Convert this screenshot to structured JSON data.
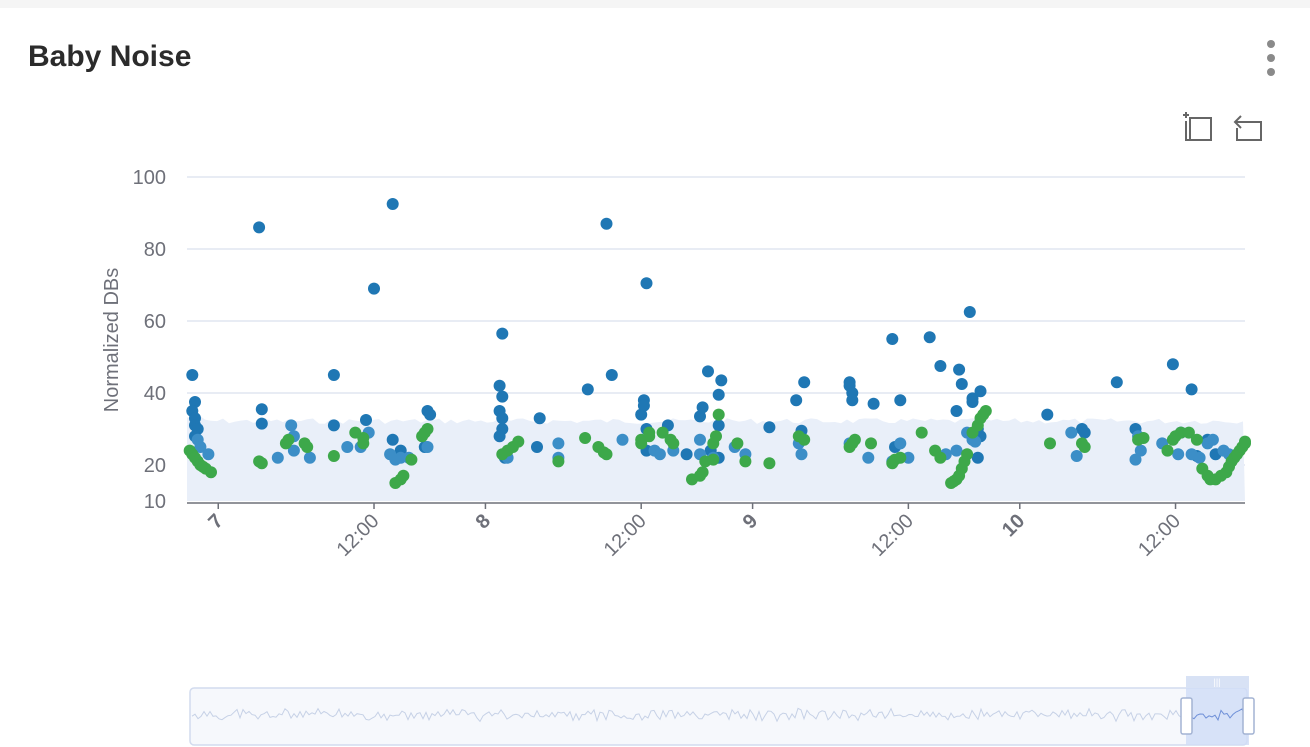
{
  "card": {
    "title": "Baby Noise"
  },
  "toolbox": {
    "zoom_icon": "zoom-area-icon",
    "restore_icon": "zoom-reset-icon",
    "menu_icon": "more-vert-icon"
  },
  "chart_data": {
    "type": "scatter",
    "title": "Baby Noise",
    "ylabel": "Normalized DBs",
    "xlabel": "",
    "x_unit": "day of month (fractional)",
    "xlim": [
      6.8,
      10.76
    ],
    "ylim": [
      10,
      100
    ],
    "y_ticks": [
      10,
      20,
      40,
      60,
      80,
      100
    ],
    "x_ticks": [
      {
        "x": 6.917,
        "label": "7",
        "bold": true
      },
      {
        "x": 7.5,
        "label": "12:00",
        "bold": false
      },
      {
        "x": 7.917,
        "label": "8",
        "bold": true
      },
      {
        "x": 8.5,
        "label": "12:00",
        "bold": false
      },
      {
        "x": 8.917,
        "label": "9",
        "bold": true
      },
      {
        "x": 9.5,
        "label": "12:00",
        "bold": false
      },
      {
        "x": 9.917,
        "label": "10",
        "bold": true
      },
      {
        "x": 10.5,
        "label": "12:00",
        "bold": false
      }
    ],
    "grid": true,
    "legend": "none",
    "colors": {
      "series_dark": "#1f77b4",
      "series_light": "#3c8ec7",
      "series_green": "#3da84a",
      "band": "#e9eff9",
      "grid": "#e0e6f1"
    },
    "band_upper": 33,
    "series": [
      {
        "color": "#1f77b4",
        "points": [
          [
            6.82,
            45
          ],
          [
            6.83,
            37.5
          ],
          [
            6.82,
            35
          ],
          [
            6.83,
            33
          ],
          [
            6.83,
            31
          ],
          [
            6.84,
            30
          ],
          [
            6.83,
            28
          ],
          [
            7.07,
            86
          ],
          [
            7.08,
            35.5
          ],
          [
            7.08,
            31.5
          ],
          [
            7.35,
            45
          ],
          [
            7.35,
            31
          ],
          [
            7.47,
            32.5
          ],
          [
            7.5,
            69
          ],
          [
            7.57,
            92.5
          ],
          [
            7.57,
            27
          ],
          [
            7.6,
            24
          ],
          [
            7.7,
            35
          ],
          [
            7.71,
            34
          ],
          [
            7.69,
            25
          ],
          [
            7.98,
            56.5
          ],
          [
            7.97,
            42
          ],
          [
            7.98,
            39
          ],
          [
            7.97,
            35
          ],
          [
            7.98,
            33
          ],
          [
            7.98,
            30
          ],
          [
            7.97,
            28
          ],
          [
            7.99,
            22
          ],
          [
            8.12,
            33
          ],
          [
            8.11,
            25
          ],
          [
            8.3,
            41
          ],
          [
            8.37,
            87
          ],
          [
            8.39,
            45
          ],
          [
            8.5,
            34
          ],
          [
            8.51,
            38
          ],
          [
            8.51,
            36.5
          ],
          [
            8.52,
            70.5
          ],
          [
            8.52,
            30
          ],
          [
            8.52,
            24
          ],
          [
            8.6,
            31
          ],
          [
            8.67,
            23
          ],
          [
            8.72,
            33.5
          ],
          [
            8.73,
            36
          ],
          [
            8.75,
            46
          ],
          [
            8.76,
            24
          ],
          [
            8.8,
            43.5
          ],
          [
            8.79,
            39.5
          ],
          [
            8.79,
            31
          ],
          [
            8.79,
            22
          ],
          [
            8.98,
            30.5
          ],
          [
            9.08,
            38
          ],
          [
            9.11,
            43
          ],
          [
            9.1,
            29.5
          ],
          [
            9.28,
            43
          ],
          [
            9.28,
            42
          ],
          [
            9.29,
            40
          ],
          [
            9.29,
            38
          ],
          [
            9.37,
            37
          ],
          [
            9.44,
            55
          ],
          [
            9.47,
            38
          ],
          [
            9.45,
            25
          ],
          [
            9.58,
            55.5
          ],
          [
            9.62,
            47.5
          ],
          [
            9.68,
            35
          ],
          [
            9.69,
            46.5
          ],
          [
            9.7,
            42.5
          ],
          [
            9.73,
            62.5
          ],
          [
            9.74,
            38.5
          ],
          [
            9.74,
            37.5
          ],
          [
            9.77,
            40.5
          ],
          [
            9.76,
            30
          ],
          [
            9.77,
            28
          ],
          [
            9.76,
            22
          ],
          [
            10.02,
            34
          ],
          [
            10.15,
            30
          ],
          [
            10.16,
            29
          ],
          [
            10.28,
            43
          ],
          [
            10.35,
            30
          ],
          [
            10.49,
            48
          ],
          [
            10.56,
            41
          ],
          [
            10.52,
            29
          ],
          [
            10.58,
            22.5
          ],
          [
            10.62,
            27
          ],
          [
            10.65,
            23
          ]
        ]
      },
      {
        "color": "#3c8ec7",
        "points": [
          [
            6.84,
            27
          ],
          [
            6.85,
            25
          ],
          [
            6.88,
            23
          ],
          [
            7.4,
            25
          ],
          [
            7.45,
            25
          ],
          [
            7.56,
            23
          ],
          [
            7.6,
            22
          ],
          [
            7.48,
            29
          ],
          [
            7.19,
            31
          ],
          [
            7.2,
            28
          ],
          [
            7.2,
            24
          ],
          [
            7.26,
            22
          ],
          [
            7.14,
            22
          ],
          [
            7.58,
            21.5
          ],
          [
            7.63,
            22
          ],
          [
            7.7,
            25
          ],
          [
            8.0,
            22
          ],
          [
            8.19,
            26
          ],
          [
            8.19,
            22
          ],
          [
            8.43,
            27
          ],
          [
            8.55,
            24
          ],
          [
            8.57,
            23
          ],
          [
            8.62,
            24
          ],
          [
            8.72,
            23
          ],
          [
            8.72,
            27
          ],
          [
            8.77,
            22
          ],
          [
            8.85,
            25
          ],
          [
            8.89,
            23
          ],
          [
            9.1,
            23
          ],
          [
            9.09,
            26
          ],
          [
            9.28,
            26
          ],
          [
            9.35,
            22
          ],
          [
            9.44,
            21
          ],
          [
            9.47,
            26
          ],
          [
            9.5,
            22
          ],
          [
            9.64,
            23
          ],
          [
            9.72,
            29
          ],
          [
            9.74,
            27
          ],
          [
            9.75,
            26.5
          ],
          [
            9.68,
            24
          ],
          [
            10.11,
            29
          ],
          [
            10.13,
            22.5
          ],
          [
            10.36,
            28
          ],
          [
            10.35,
            21.5
          ],
          [
            10.37,
            24
          ],
          [
            10.45,
            26
          ],
          [
            10.51,
            23
          ],
          [
            10.56,
            23
          ],
          [
            10.59,
            22
          ],
          [
            10.62,
            26
          ],
          [
            10.64,
            27
          ],
          [
            10.68,
            24
          ],
          [
            10.7,
            23
          ]
        ]
      },
      {
        "color": "#3da84a",
        "points": [
          [
            6.81,
            24
          ],
          [
            6.82,
            23
          ],
          [
            6.83,
            22
          ],
          [
            6.84,
            21
          ],
          [
            6.85,
            20
          ],
          [
            6.86,
            19.5
          ],
          [
            6.87,
            19
          ],
          [
            6.89,
            18
          ],
          [
            7.07,
            21
          ],
          [
            7.08,
            20.5
          ],
          [
            7.17,
            26
          ],
          [
            7.18,
            27
          ],
          [
            7.24,
            26
          ],
          [
            7.25,
            25
          ],
          [
            7.35,
            22.5
          ],
          [
            7.43,
            29
          ],
          [
            7.46,
            27.5
          ],
          [
            7.46,
            26
          ],
          [
            7.58,
            15
          ],
          [
            7.6,
            16
          ],
          [
            7.61,
            17
          ],
          [
            7.64,
            21.5
          ],
          [
            7.68,
            28
          ],
          [
            7.7,
            30
          ],
          [
            7.69,
            29
          ],
          [
            7.98,
            23
          ],
          [
            8.0,
            24
          ],
          [
            8.02,
            25
          ],
          [
            8.04,
            26.5
          ],
          [
            8.19,
            21
          ],
          [
            8.29,
            27.5
          ],
          [
            8.34,
            25
          ],
          [
            8.36,
            23.5
          ],
          [
            8.37,
            23
          ],
          [
            8.5,
            26
          ],
          [
            8.5,
            27
          ],
          [
            8.53,
            28
          ],
          [
            8.53,
            29
          ],
          [
            8.58,
            29
          ],
          [
            8.61,
            27
          ],
          [
            8.62,
            26
          ],
          [
            8.69,
            16
          ],
          [
            8.72,
            17
          ],
          [
            8.73,
            18
          ],
          [
            8.74,
            21
          ],
          [
            8.77,
            21.5
          ],
          [
            8.77,
            26
          ],
          [
            8.78,
            28
          ],
          [
            8.79,
            34
          ],
          [
            8.86,
            26
          ],
          [
            8.89,
            21
          ],
          [
            8.98,
            20.5
          ],
          [
            9.09,
            28
          ],
          [
            9.11,
            27
          ],
          [
            9.28,
            25
          ],
          [
            9.29,
            26
          ],
          [
            9.3,
            27
          ],
          [
            9.36,
            26
          ],
          [
            9.44,
            20.5
          ],
          [
            9.45,
            21.5
          ],
          [
            9.47,
            22
          ],
          [
            9.55,
            29
          ],
          [
            9.6,
            24
          ],
          [
            9.62,
            22
          ],
          [
            9.66,
            15
          ],
          [
            9.67,
            15.5
          ],
          [
            9.68,
            16
          ],
          [
            9.69,
            17
          ],
          [
            9.7,
            19
          ],
          [
            9.71,
            21
          ],
          [
            9.72,
            23
          ],
          [
            9.74,
            29
          ],
          [
            9.76,
            31
          ],
          [
            9.77,
            33
          ],
          [
            9.78,
            34
          ],
          [
            9.79,
            35
          ],
          [
            10.03,
            26
          ],
          [
            10.15,
            26
          ],
          [
            10.16,
            25
          ],
          [
            10.36,
            27
          ],
          [
            10.38,
            27.5
          ],
          [
            10.47,
            24
          ],
          [
            10.49,
            27
          ],
          [
            10.5,
            28
          ],
          [
            10.52,
            29
          ],
          [
            10.55,
            29
          ],
          [
            10.58,
            27
          ],
          [
            10.6,
            19
          ],
          [
            10.62,
            17
          ],
          [
            10.63,
            16
          ],
          [
            10.65,
            16
          ],
          [
            10.67,
            17
          ],
          [
            10.69,
            18
          ],
          [
            10.7,
            19.5
          ],
          [
            10.71,
            21
          ],
          [
            10.72,
            22
          ],
          [
            10.73,
            23
          ],
          [
            10.74,
            24
          ],
          [
            10.75,
            25
          ],
          [
            10.76,
            26
          ],
          [
            10.76,
            26.5
          ]
        ]
      }
    ]
  }
}
